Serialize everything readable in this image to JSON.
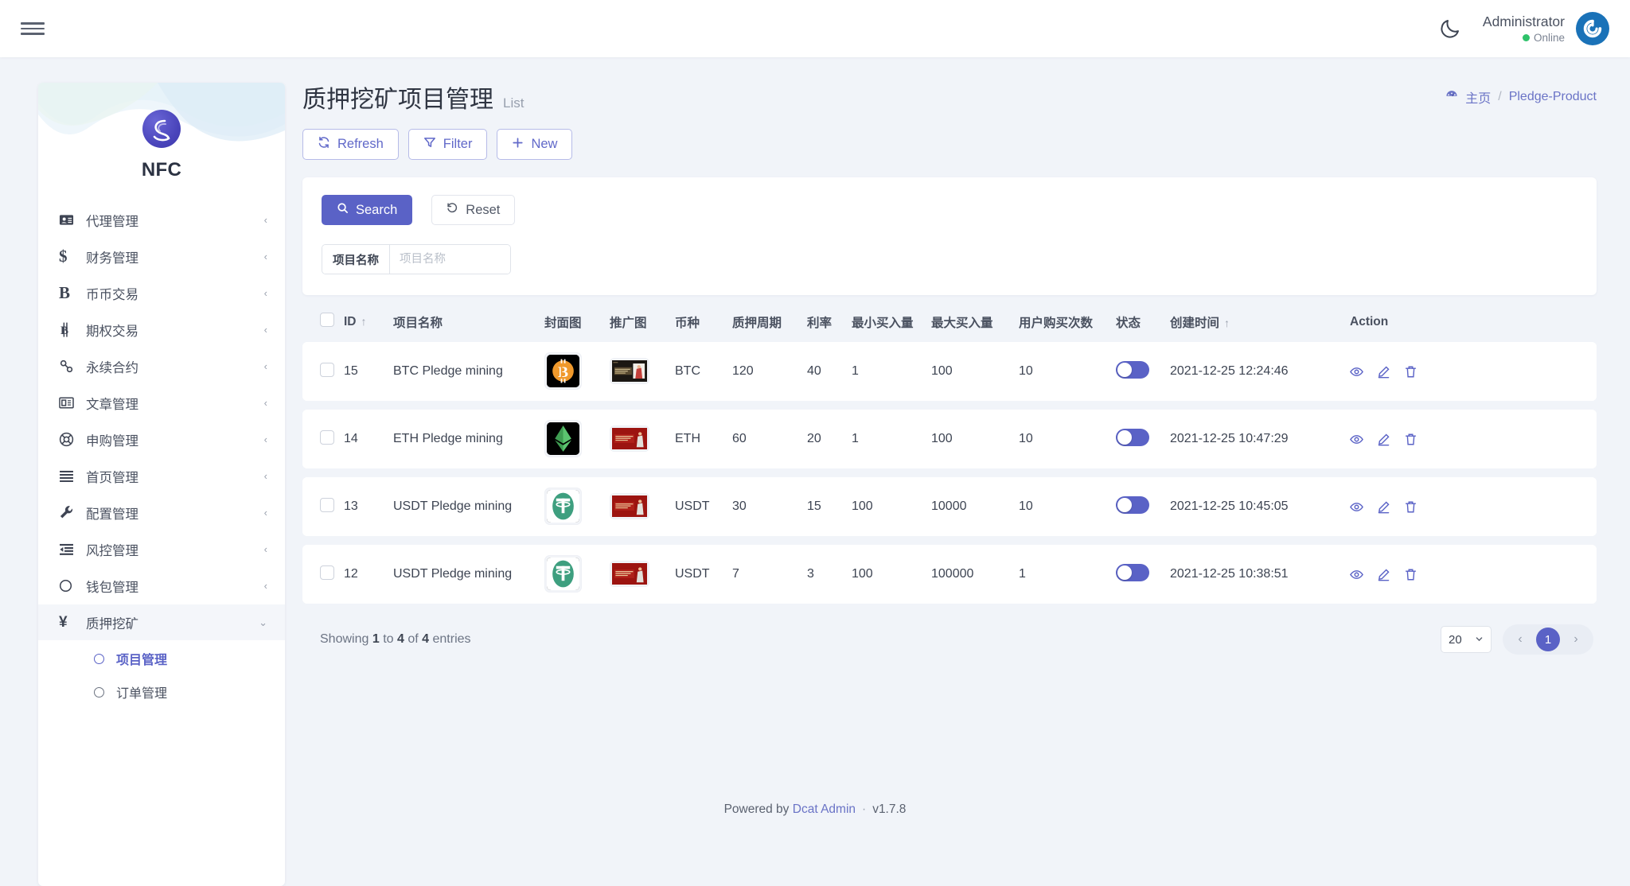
{
  "topbar": {
    "menu_toggle": "menu",
    "theme_toggle_icon": "moon-icon",
    "user_name": "Administrator",
    "user_status": "Online",
    "avatar_icon": "power-logo-icon"
  },
  "sidebar": {
    "brand": "NFC",
    "items": [
      {
        "label": "代理管理",
        "icon": "id-card-icon",
        "chevron": "‹"
      },
      {
        "label": "财务管理",
        "icon": "dollar-icon",
        "chevron": "‹"
      },
      {
        "label": "币币交易",
        "icon": "letter-b-icon",
        "chevron": "‹"
      },
      {
        "label": "期权交易",
        "icon": "bitcoin-b-icon",
        "chevron": "‹"
      },
      {
        "label": "永续合约",
        "icon": "link-chain-icon",
        "chevron": "‹"
      },
      {
        "label": "文章管理",
        "icon": "newspaper-icon",
        "chevron": "‹"
      },
      {
        "label": "申购管理",
        "icon": "lifebuoy-icon",
        "chevron": "‹"
      },
      {
        "label": "首页管理",
        "icon": "list-lines-icon",
        "chevron": "‹"
      },
      {
        "label": "配置管理",
        "icon": "wrench-icon",
        "chevron": "‹"
      },
      {
        "label": "风控管理",
        "icon": "indent-icon",
        "chevron": "‹"
      },
      {
        "label": "钱包管理",
        "icon": "circle-icon",
        "chevron": "‹"
      }
    ],
    "open_group": {
      "label": "质押挖矿",
      "icon": "yen-icon",
      "chevron": "⌄"
    },
    "submenu": [
      {
        "label": "项目管理",
        "icon": "circle-icon",
        "active": true
      },
      {
        "label": "订单管理",
        "icon": "circle-icon",
        "active": false
      }
    ]
  },
  "page": {
    "title": "质押挖矿项目管理",
    "subtitle": "List",
    "breadcrumb_home": "主页",
    "breadcrumb_sep": "/",
    "breadcrumb_current": "Pledge-Product",
    "breadcrumb_home_icon": "dashboard-icon"
  },
  "toolbar": {
    "refresh_label": "Refresh",
    "refresh_icon": "refresh-icon",
    "filter_label": "Filter",
    "filter_icon": "funnel-icon",
    "new_label": "New",
    "new_icon": "plus-icon"
  },
  "filter": {
    "search_label": "Search",
    "search_icon": "search-icon",
    "reset_label": "Reset",
    "reset_icon": "undo-icon",
    "field_label": "项目名称",
    "field_value": "",
    "field_placeholder": "项目名称"
  },
  "table": {
    "columns": [
      {
        "label": "",
        "key": "check"
      },
      {
        "label": "ID",
        "sort": "↑"
      },
      {
        "label": "项目名称"
      },
      {
        "label": "封面图"
      },
      {
        "label": "推广图"
      },
      {
        "label": "币种"
      },
      {
        "label": "质押周期"
      },
      {
        "label": "利率"
      },
      {
        "label": "最小买入量"
      },
      {
        "label": "最大买入量"
      },
      {
        "label": "用户购买次数"
      },
      {
        "label": "状态"
      },
      {
        "label": "创建时间",
        "sort": "↑"
      },
      {
        "label": "Action"
      }
    ],
    "rows": [
      {
        "id": "15",
        "name": "BTC Pledge mining",
        "cover": "btc",
        "promo": "dark-card",
        "coin": "BTC",
        "period": "120",
        "rate": "40",
        "min_buy": "1",
        "max_buy": "100",
        "times": "10",
        "status_on": true,
        "created_at": "2021-12-25 12:24:46"
      },
      {
        "id": "14",
        "name": "ETH Pledge mining",
        "cover": "eth",
        "promo": "red-card",
        "coin": "ETH",
        "period": "60",
        "rate": "20",
        "min_buy": "1",
        "max_buy": "100",
        "times": "10",
        "status_on": true,
        "created_at": "2021-12-25 10:47:29"
      },
      {
        "id": "13",
        "name": "USDT Pledge mining",
        "cover": "usdt",
        "promo": "red-card",
        "coin": "USDT",
        "period": "30",
        "rate": "15",
        "min_buy": "100",
        "max_buy": "10000",
        "times": "10",
        "status_on": true,
        "created_at": "2021-12-25 10:45:05"
      },
      {
        "id": "12",
        "name": "USDT Pledge mining",
        "cover": "usdt",
        "promo": "red-card",
        "coin": "USDT",
        "period": "7",
        "rate": "3",
        "min_buy": "100",
        "max_buy": "100000",
        "times": "1",
        "status_on": true,
        "created_at": "2021-12-25 10:38:51"
      }
    ],
    "action_icons": [
      "eye-icon",
      "pencil-icon",
      "trash-icon"
    ]
  },
  "pagination": {
    "showing_prefix": "Showing",
    "from": "1",
    "to_word": "to",
    "to": "4",
    "of_word": "of",
    "total": "4",
    "entries_word": "entries",
    "per_page": "20",
    "prev_icon": "‹",
    "next_icon": "›",
    "current_page": "1"
  },
  "footer": {
    "powered_by": "Powered by",
    "brand": "Dcat Admin",
    "separator": "·",
    "version": "v1.7.8"
  },
  "colors": {
    "accent": "#5a62c6",
    "page_bg": "#f1f4f9",
    "online": "#2ec26a",
    "avatar": "#1a72b8"
  }
}
